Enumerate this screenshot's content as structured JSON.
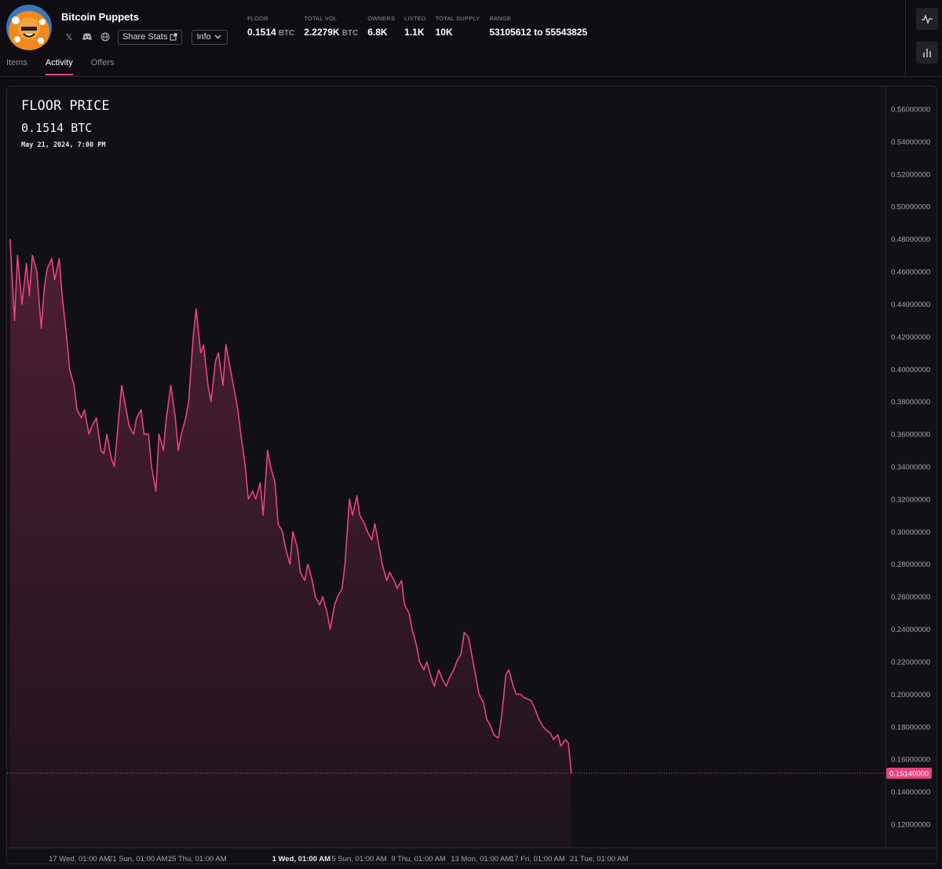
{
  "collection": {
    "name": "Bitcoin Puppets",
    "share_label": "Share Stats",
    "info_label": "Info"
  },
  "stats": [
    {
      "label": "FLOOR",
      "value": "0.1514",
      "unit": "BTC"
    },
    {
      "label": "TOTAL VOL",
      "value": "2.2279K",
      "unit": "BTC"
    },
    {
      "label": "OWNERS",
      "value": "6.8K",
      "unit": ""
    },
    {
      "label": "LISTED",
      "value": "1.1K",
      "unit": ""
    },
    {
      "label": "TOTAL SUPPLY",
      "value": "10K",
      "unit": ""
    },
    {
      "label": "RANGE",
      "value": "53105612 to 55543825",
      "unit": ""
    }
  ],
  "tabs": [
    {
      "label": "Items"
    },
    {
      "label": "Activity",
      "active": true
    },
    {
      "label": "Offers"
    }
  ],
  "icons": {
    "x": "x-icon",
    "discord": "discord-icon",
    "website": "globe-icon",
    "share": "external-link-icon",
    "info": "chevron-down-icon",
    "line_view": "line-chart-icon",
    "bar_view": "bar-chart-icon"
  },
  "colors": {
    "accent": "#e6457f",
    "background": "#0f0d12",
    "panel": "#111015"
  },
  "chart_header": {
    "title": "FLOOR PRICE",
    "price": "0.1514 BTC",
    "date": "May 21, 2024, 7:00 PM"
  },
  "chart_data": {
    "type": "area",
    "title": "FLOOR PRICE",
    "ylim": [
      0.11,
      0.57
    ],
    "current_value_label": "0.15140000",
    "current_value": 0.1514,
    "y_ticks": [
      "0.56000000",
      "0.54000000",
      "0.52000000",
      "0.50000000",
      "0.48000000",
      "0.46000000",
      "0.44000000",
      "0.42000000",
      "0.40000000",
      "0.38000000",
      "0.36000000",
      "0.34000000",
      "0.32000000",
      "0.30000000",
      "0.28000000",
      "0.26000000",
      "0.24000000",
      "0.22000000",
      "0.20000000",
      "0.18000000",
      "0.16000000",
      "0.14000000",
      "0.12000000"
    ],
    "x_ticks": [
      {
        "label": "17 Wed, 01:00 AM",
        "day": 16.6
      },
      {
        "label": "21 Sun, 01:00 AM",
        "day": 20.6
      },
      {
        "label": "25 Thu, 01:00 AM",
        "day": 24.6
      },
      {
        "label": "1 Wed, 01:00 AM",
        "day": 31.6,
        "bold": true
      },
      {
        "label": "5 Sun, 01:00 AM",
        "day": 35.6
      },
      {
        "label": "9 Thu, 01:00 AM",
        "day": 39.6
      },
      {
        "label": "13 Mon, 01:00 AM",
        "day": 43.6
      },
      {
        "label": "17 Fri, 01:00 AM",
        "day": 47.6
      },
      {
        "label": "21 Tue, 01:00 AM",
        "day": 51.6
      }
    ],
    "x_range": [
      13.8,
      72.8
    ],
    "series": [
      {
        "values": [
          [
            14.0,
            0.48
          ],
          [
            14.3,
            0.43
          ],
          [
            14.5,
            0.47
          ],
          [
            14.8,
            0.44
          ],
          [
            15.1,
            0.465
          ],
          [
            15.3,
            0.445
          ],
          [
            15.5,
            0.47
          ],
          [
            15.8,
            0.46
          ],
          [
            16.1,
            0.425
          ],
          [
            16.3,
            0.45
          ],
          [
            16.5,
            0.462
          ],
          [
            16.8,
            0.468
          ],
          [
            17.0,
            0.455
          ],
          [
            17.3,
            0.468
          ],
          [
            17.5,
            0.445
          ],
          [
            17.8,
            0.42
          ],
          [
            18.0,
            0.4
          ],
          [
            18.3,
            0.39
          ],
          [
            18.5,
            0.375
          ],
          [
            18.8,
            0.37
          ],
          [
            19.0,
            0.375
          ],
          [
            19.3,
            0.36
          ],
          [
            19.5,
            0.365
          ],
          [
            19.8,
            0.37
          ],
          [
            20.1,
            0.35
          ],
          [
            20.3,
            0.348
          ],
          [
            20.5,
            0.36
          ],
          [
            20.8,
            0.345
          ],
          [
            21.0,
            0.34
          ],
          [
            21.3,
            0.37
          ],
          [
            21.5,
            0.39
          ],
          [
            21.8,
            0.375
          ],
          [
            22.0,
            0.365
          ],
          [
            22.3,
            0.36
          ],
          [
            22.5,
            0.37
          ],
          [
            22.8,
            0.375
          ],
          [
            23.0,
            0.36
          ],
          [
            23.3,
            0.36
          ],
          [
            23.5,
            0.34
          ],
          [
            23.8,
            0.325
          ],
          [
            24.0,
            0.36
          ],
          [
            24.3,
            0.35
          ],
          [
            24.5,
            0.37
          ],
          [
            24.8,
            0.39
          ],
          [
            25.1,
            0.37
          ],
          [
            25.3,
            0.35
          ],
          [
            25.5,
            0.36
          ],
          [
            25.8,
            0.37
          ],
          [
            26.0,
            0.38
          ],
          [
            26.3,
            0.42
          ],
          [
            26.5,
            0.437
          ],
          [
            26.8,
            0.41
          ],
          [
            27.0,
            0.415
          ],
          [
            27.3,
            0.39
          ],
          [
            27.5,
            0.38
          ],
          [
            27.8,
            0.405
          ],
          [
            28.0,
            0.41
          ],
          [
            28.3,
            0.39
          ],
          [
            28.5,
            0.415
          ],
          [
            28.8,
            0.4
          ],
          [
            29.0,
            0.39
          ],
          [
            29.3,
            0.375
          ],
          [
            29.5,
            0.36
          ],
          [
            29.8,
            0.34
          ],
          [
            30.0,
            0.32
          ],
          [
            30.3,
            0.325
          ],
          [
            30.5,
            0.32
          ],
          [
            30.8,
            0.33
          ],
          [
            31.0,
            0.31
          ],
          [
            31.3,
            0.35
          ],
          [
            31.5,
            0.34
          ],
          [
            31.8,
            0.33
          ],
          [
            32.0,
            0.305
          ],
          [
            32.3,
            0.3
          ],
          [
            32.5,
            0.29
          ],
          [
            32.8,
            0.28
          ],
          [
            33.0,
            0.3
          ],
          [
            33.3,
            0.29
          ],
          [
            33.5,
            0.275
          ],
          [
            33.8,
            0.27
          ],
          [
            34.0,
            0.28
          ],
          [
            34.3,
            0.27
          ],
          [
            34.5,
            0.26
          ],
          [
            34.8,
            0.255
          ],
          [
            35.0,
            0.26
          ],
          [
            35.3,
            0.25
          ],
          [
            35.5,
            0.24
          ],
          [
            35.8,
            0.255
          ],
          [
            36.0,
            0.26
          ],
          [
            36.3,
            0.265
          ],
          [
            36.5,
            0.28
          ],
          [
            36.8,
            0.32
          ],
          [
            37.0,
            0.31
          ],
          [
            37.3,
            0.322
          ],
          [
            37.5,
            0.31
          ],
          [
            37.8,
            0.305
          ],
          [
            38.0,
            0.3
          ],
          [
            38.3,
            0.295
          ],
          [
            38.5,
            0.305
          ],
          [
            38.8,
            0.29
          ],
          [
            39.0,
            0.28
          ],
          [
            39.3,
            0.27
          ],
          [
            39.5,
            0.275
          ],
          [
            39.8,
            0.27
          ],
          [
            40.0,
            0.265
          ],
          [
            40.3,
            0.27
          ],
          [
            40.5,
            0.255
          ],
          [
            40.8,
            0.25
          ],
          [
            41.0,
            0.24
          ],
          [
            41.3,
            0.23
          ],
          [
            41.5,
            0.22
          ],
          [
            41.8,
            0.215
          ],
          [
            42.0,
            0.22
          ],
          [
            42.3,
            0.21
          ],
          [
            42.5,
            0.205
          ],
          [
            42.8,
            0.215
          ],
          [
            43.0,
            0.21
          ],
          [
            43.3,
            0.205
          ],
          [
            43.5,
            0.21
          ],
          [
            43.8,
            0.215
          ],
          [
            44.0,
            0.22
          ],
          [
            44.3,
            0.225
          ],
          [
            44.5,
            0.238
          ],
          [
            44.8,
            0.235
          ],
          [
            45.0,
            0.225
          ],
          [
            45.3,
            0.21
          ],
          [
            45.5,
            0.2
          ],
          [
            45.8,
            0.195
          ],
          [
            46.0,
            0.185
          ],
          [
            46.3,
            0.18
          ],
          [
            46.5,
            0.175
          ],
          [
            46.8,
            0.173
          ],
          [
            47.0,
            0.185
          ],
          [
            47.3,
            0.212
          ],
          [
            47.5,
            0.215
          ],
          [
            47.8,
            0.205
          ],
          [
            48.0,
            0.2
          ],
          [
            48.3,
            0.2
          ],
          [
            48.5,
            0.198
          ],
          [
            48.8,
            0.197
          ],
          [
            49.0,
            0.196
          ],
          [
            49.3,
            0.19
          ],
          [
            49.5,
            0.185
          ],
          [
            49.8,
            0.18
          ],
          [
            50.0,
            0.178
          ],
          [
            50.3,
            0.176
          ],
          [
            50.5,
            0.172
          ],
          [
            50.8,
            0.175
          ],
          [
            51.0,
            0.168
          ],
          [
            51.3,
            0.172
          ],
          [
            51.5,
            0.17
          ],
          [
            51.7,
            0.1514
          ]
        ]
      }
    ]
  }
}
